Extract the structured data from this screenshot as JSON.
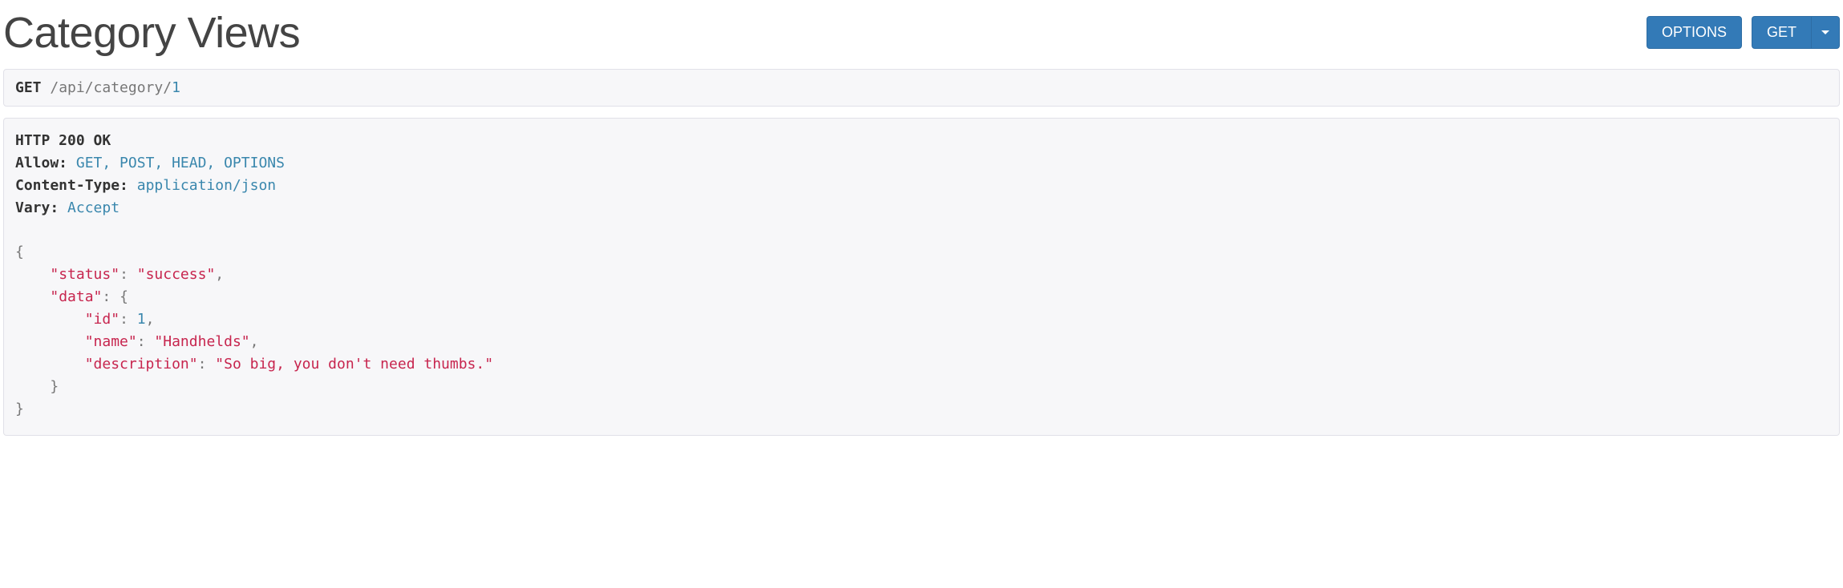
{
  "header": {
    "title": "Category Views",
    "options_label": "OPTIONS",
    "get_label": "GET"
  },
  "request": {
    "method": "GET",
    "path_prefix": " /api/category/",
    "path_id": "1"
  },
  "response": {
    "status_line": "HTTP 200 OK",
    "headers": {
      "allow_label": "Allow:",
      "allow_value": " GET, POST, HEAD, OPTIONS",
      "content_type_label": "Content-Type:",
      "content_type_value": " application/json",
      "vary_label": "Vary:",
      "vary_value": " Accept"
    },
    "body": {
      "status_key": "\"status\"",
      "status_value": "\"success\"",
      "data_key": "\"data\"",
      "id_key": "\"id\"",
      "id_value": "1",
      "name_key": "\"name\"",
      "name_value": "\"Handhelds\"",
      "description_key": "\"description\"",
      "description_value": "\"So big, you don't need thumbs.\""
    }
  }
}
